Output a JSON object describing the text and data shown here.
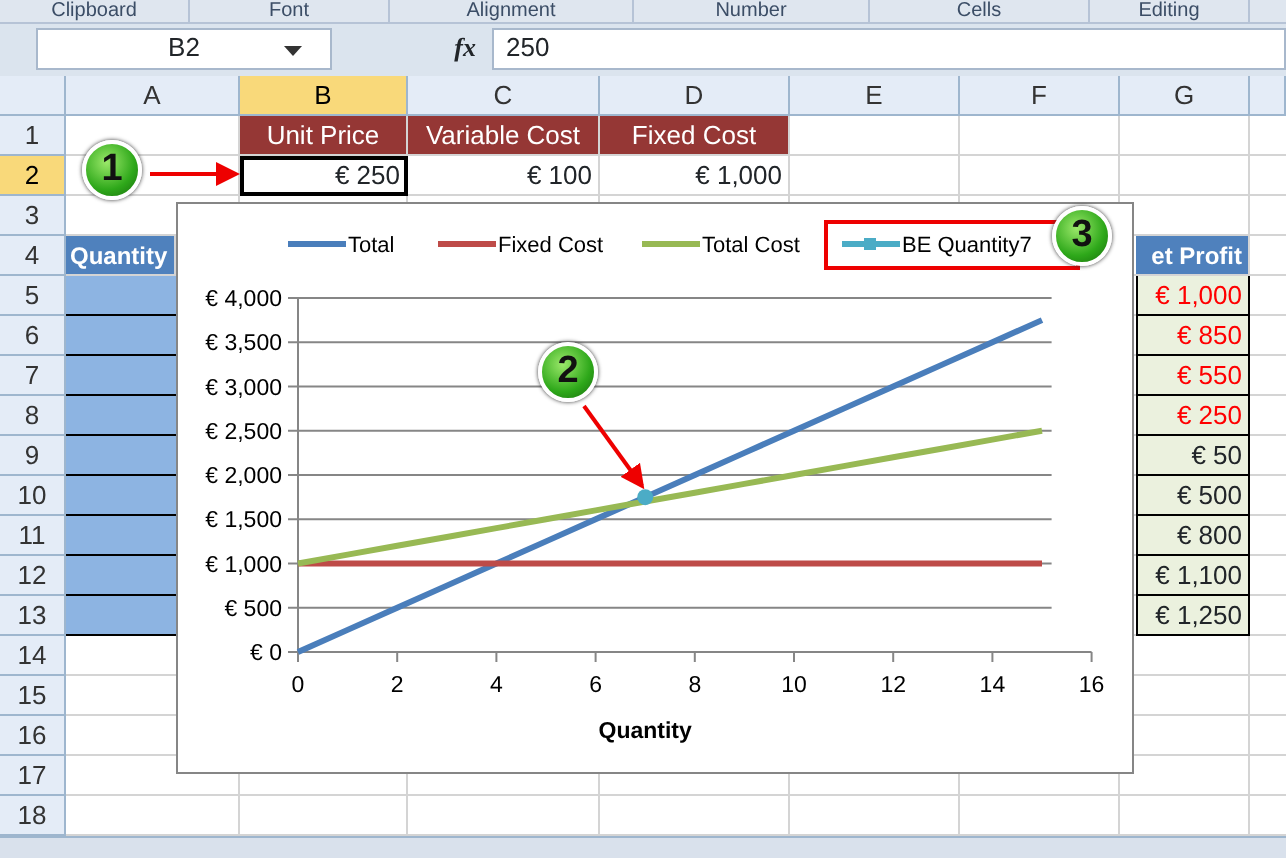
{
  "ribbon_groups": [
    "Clipboard",
    "Font",
    "Alignment",
    "Number",
    "Cells",
    "Editing"
  ],
  "formula_bar": {
    "name_box": "B2",
    "function_label": "fx",
    "formula": "250"
  },
  "columns": [
    {
      "label": "A",
      "selected": false
    },
    {
      "label": "B",
      "selected": true
    },
    {
      "label": "C",
      "selected": false
    },
    {
      "label": "D",
      "selected": false
    },
    {
      "label": "E",
      "selected": false
    },
    {
      "label": "F",
      "selected": false
    },
    {
      "label": "G",
      "selected": false
    }
  ],
  "rows": [
    {
      "label": "1",
      "selected": false,
      "cells": [
        {
          "kind": "empty"
        },
        {
          "kind": "header",
          "text": "Unit Price",
          "selected": false
        },
        {
          "kind": "header",
          "text": "Variable Cost",
          "selected": false
        },
        {
          "kind": "header",
          "text": "Fixed Cost",
          "selected": false
        },
        {
          "kind": "empty"
        },
        {
          "kind": "empty"
        },
        {
          "kind": "empty"
        }
      ]
    },
    {
      "label": "2",
      "selected": true,
      "cells": [
        {
          "kind": "empty"
        },
        {
          "kind": "value",
          "text": "€ 250",
          "selected": true
        },
        {
          "kind": "value",
          "text": "€ 100",
          "selected": false
        },
        {
          "kind": "value",
          "text": "€ 1,000",
          "selected": false
        },
        {
          "kind": "empty"
        },
        {
          "kind": "empty"
        },
        {
          "kind": "empty"
        }
      ]
    },
    {
      "label": "3",
      "selected": false
    },
    {
      "label": "4",
      "selected": false,
      "cells": [
        {
          "kind": "table_header",
          "text": "Quantity",
          "selected": false
        },
        {
          "kind": "empty"
        },
        {
          "kind": "empty"
        },
        {
          "kind": "empty"
        },
        {
          "kind": "empty"
        },
        {
          "kind": "empty"
        },
        {
          "kind": "table_header",
          "text": "et Profit",
          "selected": false
        }
      ]
    },
    {
      "label": "5",
      "selected": false,
      "cells": [
        {
          "kind": "input",
          "selected": false
        },
        {
          "kind": "empty"
        },
        {
          "kind": "empty"
        },
        {
          "kind": "empty"
        },
        {
          "kind": "empty"
        },
        {
          "kind": "empty"
        },
        {
          "kind": "result",
          "text": "€ 1,000",
          "negative": true,
          "selected": false
        }
      ]
    },
    {
      "label": "6",
      "selected": false,
      "cells": [
        {
          "kind": "input",
          "selected": false
        },
        {
          "kind": "empty"
        },
        {
          "kind": "empty"
        },
        {
          "kind": "empty"
        },
        {
          "kind": "empty"
        },
        {
          "kind": "empty"
        },
        {
          "kind": "result",
          "text": "€ 850",
          "negative": true,
          "selected": false
        }
      ]
    },
    {
      "label": "7",
      "selected": false,
      "cells": [
        {
          "kind": "input",
          "selected": false
        },
        {
          "kind": "empty"
        },
        {
          "kind": "empty"
        },
        {
          "kind": "empty"
        },
        {
          "kind": "empty"
        },
        {
          "kind": "empty"
        },
        {
          "kind": "result",
          "text": "€ 550",
          "negative": true,
          "selected": false
        }
      ]
    },
    {
      "label": "8",
      "selected": false,
      "cells": [
        {
          "kind": "input",
          "selected": false
        },
        {
          "kind": "empty"
        },
        {
          "kind": "empty"
        },
        {
          "kind": "empty"
        },
        {
          "kind": "empty"
        },
        {
          "kind": "empty"
        },
        {
          "kind": "result",
          "text": "€ 250",
          "negative": true,
          "selected": false
        }
      ]
    },
    {
      "label": "9",
      "selected": false,
      "cells": [
        {
          "kind": "input",
          "selected": false
        },
        {
          "kind": "empty"
        },
        {
          "kind": "empty"
        },
        {
          "kind": "empty"
        },
        {
          "kind": "empty"
        },
        {
          "kind": "empty"
        },
        {
          "kind": "result",
          "text": "€ 50",
          "negative": false,
          "selected": false
        }
      ]
    },
    {
      "label": "10",
      "selected": false,
      "cells": [
        {
          "kind": "input",
          "selected": false
        },
        {
          "kind": "empty"
        },
        {
          "kind": "empty"
        },
        {
          "kind": "empty"
        },
        {
          "kind": "empty"
        },
        {
          "kind": "empty"
        },
        {
          "kind": "result",
          "text": "€ 500",
          "negative": false,
          "selected": false
        }
      ]
    },
    {
      "label": "11",
      "selected": false,
      "cells": [
        {
          "kind": "input",
          "selected": false
        },
        {
          "kind": "empty"
        },
        {
          "kind": "empty"
        },
        {
          "kind": "empty"
        },
        {
          "kind": "empty"
        },
        {
          "kind": "empty"
        },
        {
          "kind": "result",
          "text": "€ 800",
          "negative": false,
          "selected": false
        }
      ]
    },
    {
      "label": "12",
      "selected": false,
      "cells": [
        {
          "kind": "input",
          "selected": false
        },
        {
          "kind": "empty"
        },
        {
          "kind": "empty"
        },
        {
          "kind": "empty"
        },
        {
          "kind": "empty"
        },
        {
          "kind": "empty"
        },
        {
          "kind": "result",
          "text": "€ 1,100",
          "negative": false,
          "selected": false
        }
      ]
    },
    {
      "label": "13",
      "selected": false,
      "cells": [
        {
          "kind": "input",
          "selected": false
        },
        {
          "kind": "empty"
        },
        {
          "kind": "empty"
        },
        {
          "kind": "empty"
        },
        {
          "kind": "empty"
        },
        {
          "kind": "empty"
        },
        {
          "kind": "result",
          "text": "€ 1,250",
          "negative": false,
          "selected": false
        }
      ]
    },
    {
      "label": "14",
      "selected": false
    },
    {
      "label": "15",
      "selected": false
    },
    {
      "label": "16",
      "selected": false
    },
    {
      "label": "17",
      "selected": false
    },
    {
      "label": "18",
      "selected": false
    }
  ],
  "chart": {
    "legend_marks": [
      {
        "highlighted": false
      },
      {
        "highlighted": false
      },
      {
        "highlighted": false
      },
      {
        "highlighted": true
      }
    ],
    "chart_data": {
      "type": "line",
      "xlabel": "Quantity",
      "x": [
        0,
        1,
        2,
        3,
        4,
        5,
        6,
        7,
        8,
        9,
        10,
        11,
        12,
        13,
        14,
        15
      ],
      "xlim": [
        0,
        16
      ],
      "ylim": [
        0,
        4000
      ],
      "grid": true,
      "legend": true,
      "xticks": [
        {
          "value": 0,
          "label": "0"
        },
        {
          "value": 2,
          "label": "2"
        },
        {
          "value": 4,
          "label": "4"
        },
        {
          "value": 6,
          "label": "6"
        },
        {
          "value": 8,
          "label": "8"
        },
        {
          "value": 10,
          "label": "10"
        },
        {
          "value": 12,
          "label": "12"
        },
        {
          "value": 14,
          "label": "14"
        },
        {
          "value": 16,
          "label": "16"
        }
      ],
      "yticks": [
        {
          "value": 0,
          "label": "€ 0"
        },
        {
          "value": 500,
          "label": "€ 500"
        },
        {
          "value": 1000,
          "label": "€ 1,000"
        },
        {
          "value": 1500,
          "label": "€ 1,500"
        },
        {
          "value": 2000,
          "label": "€ 2,000"
        },
        {
          "value": 2500,
          "label": "€ 2,500"
        },
        {
          "value": 3000,
          "label": "€ 3,000"
        },
        {
          "value": 3500,
          "label": "€ 3,500"
        },
        {
          "value": 4000,
          "label": "€ 4,000"
        }
      ],
      "series": [
        {
          "name": "Total",
          "color": "#4a7ebb",
          "values": [
            0,
            250,
            500,
            750,
            1000,
            1250,
            1500,
            1750,
            2000,
            2250,
            2500,
            2750,
            3000,
            3250,
            3500,
            3750
          ]
        },
        {
          "name": "Fixed Cost",
          "color": "#be4b48",
          "values": [
            1000,
            1000,
            1000,
            1000,
            1000,
            1000,
            1000,
            1000,
            1000,
            1000,
            1000,
            1000,
            1000,
            1000,
            1000,
            1000
          ]
        },
        {
          "name": "Total Cost",
          "color": "#98b954",
          "values": [
            1000,
            1100,
            1200,
            1300,
            1400,
            1500,
            1600,
            1700,
            1800,
            1900,
            2000,
            2100,
            2200,
            2300,
            2400,
            2500
          ]
        },
        {
          "name": "BE Quantity7",
          "color": "#4bacc6",
          "marker": "circle",
          "values": [
            null,
            null,
            null,
            null,
            null,
            null,
            null,
            1750,
            null,
            null,
            null,
            null,
            null,
            null,
            null,
            null
          ]
        }
      ]
    }
  },
  "callouts": [
    {
      "label": "1"
    },
    {
      "label": "2"
    },
    {
      "label": "3"
    }
  ]
}
